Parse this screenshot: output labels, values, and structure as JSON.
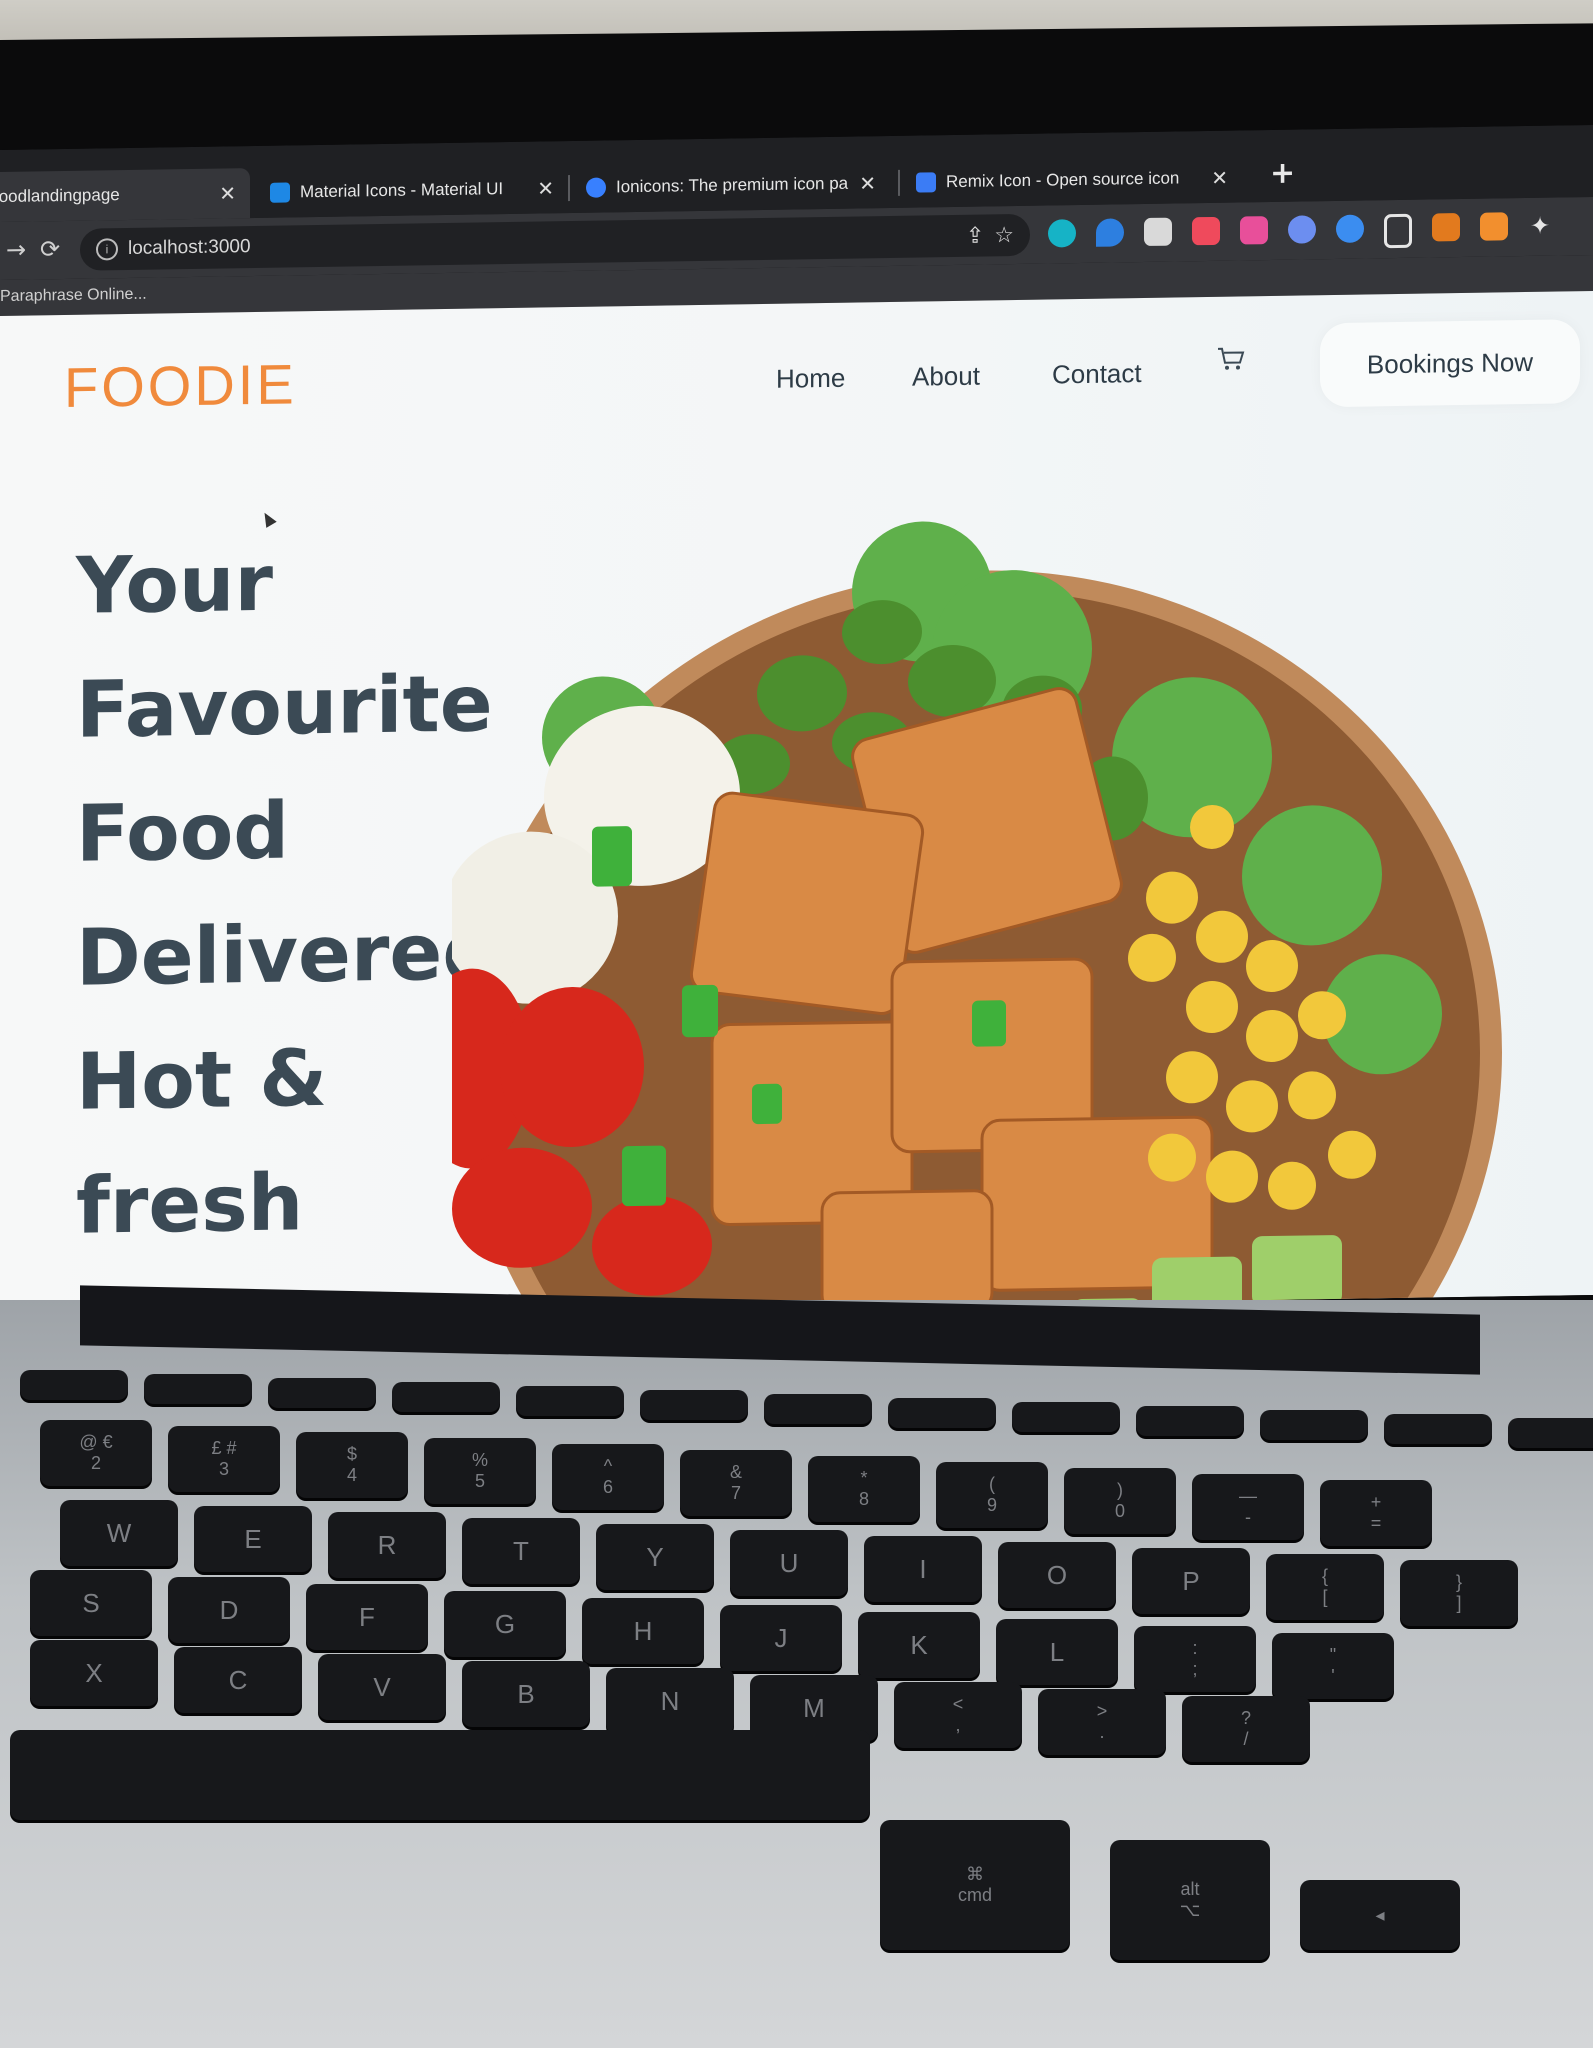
{
  "browser": {
    "tabs": [
      {
        "title": "foodlandingpage",
        "active": true
      },
      {
        "title": "Material Icons - Material UI",
        "active": false
      },
      {
        "title": "Ionicons: The premium icon pa",
        "active": false
      },
      {
        "title": "Remix Icon - Open source icon",
        "active": false
      }
    ],
    "new_tab": "+",
    "close_glyph": "✕",
    "address": "localhost:3000",
    "bookmarks": [
      "Paraphrase Online..."
    ],
    "extension_colors": [
      "#16b3c6",
      "#2d7fe0",
      "#d9d9d9",
      "#ef4a5c",
      "#e84f9a",
      "#6c8ef0",
      "#3b8df0",
      "#e6e6e6",
      "#e27a1e",
      "#f28f2e"
    ]
  },
  "site": {
    "logo": "FOODIE",
    "nav": [
      "Home",
      "About",
      "Contact"
    ],
    "cta": "Bookings Now",
    "hero_lines": [
      "Your",
      "Favourite",
      "Food",
      "Delivered",
      "Hot &",
      "fresh"
    ],
    "colors": {
      "brand": "#f08a3c",
      "text": "#3b4a55"
    }
  },
  "keyboard": {
    "row1": [
      "@ €\n2",
      "£ #\n3",
      "$\n4",
      "%\n5",
      "^\n6",
      "&\n7",
      "*\n8",
      "(\n9",
      ")\n0",
      "—\n-",
      "+\n="
    ],
    "row2": [
      "W",
      "E",
      "R",
      "T",
      "Y",
      "U",
      "I",
      "O",
      "P",
      "{\n[",
      "}\n]"
    ],
    "row3": [
      "S",
      "D",
      "F",
      "G",
      "H",
      "J",
      "K",
      "L",
      ":\n;",
      "\"\n'"
    ],
    "row4": [
      "X",
      "C",
      "V",
      "B",
      "N",
      "M",
      "<\n,",
      ">\n.",
      "?\n/"
    ],
    "cmd": "cmd",
    "alt": "alt"
  }
}
